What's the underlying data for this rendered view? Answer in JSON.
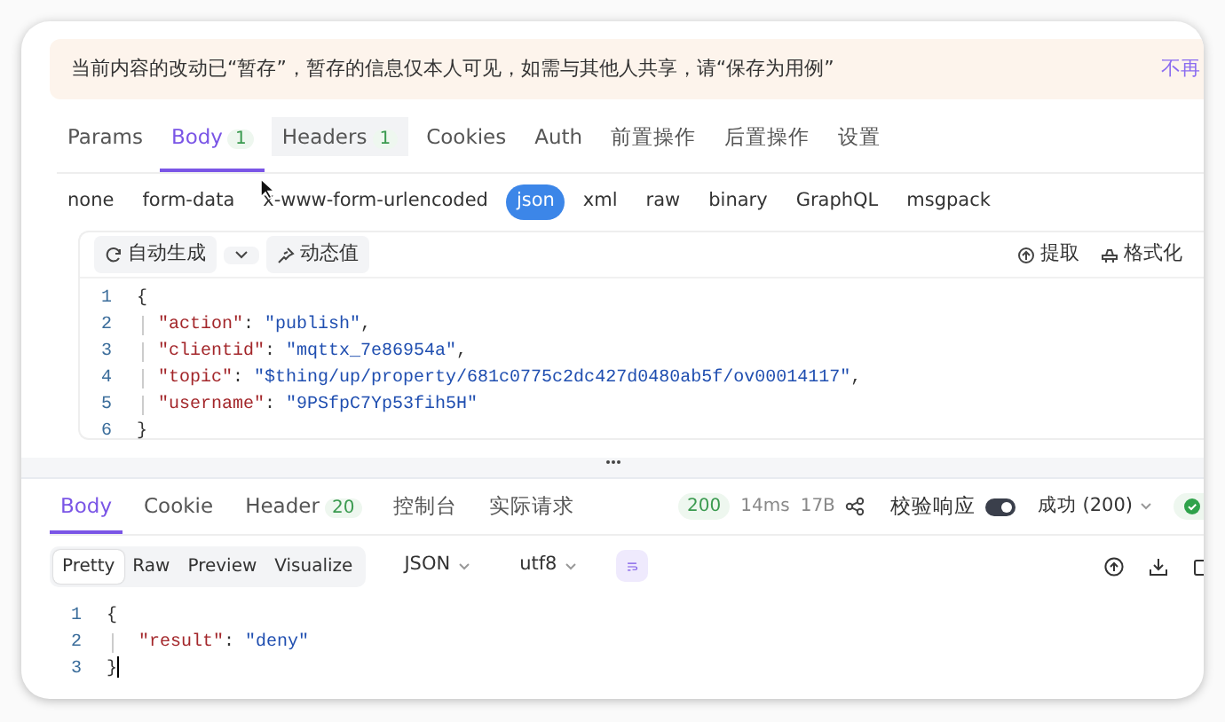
{
  "notice": {
    "text": "当前内容的改动已“暂存”，暂存的信息仅本人可见，如需与其他人共享，请“保存为用例”",
    "action": "不再"
  },
  "request_tabs": [
    {
      "label": "Params",
      "selected": false,
      "hovered": false
    },
    {
      "label": "Body",
      "count": "1",
      "selected": true,
      "hovered": false
    },
    {
      "label": "Headers",
      "count": "1",
      "selected": false,
      "hovered": true
    },
    {
      "label": "Cookies",
      "selected": false,
      "hovered": false
    },
    {
      "label": "Auth",
      "selected": false,
      "hovered": false
    },
    {
      "label": "前置操作",
      "selected": false,
      "hovered": false
    },
    {
      "label": "后置操作",
      "selected": false,
      "hovered": false
    },
    {
      "label": "设置",
      "selected": false,
      "hovered": false
    }
  ],
  "body_types": [
    {
      "label": "none",
      "selected": false
    },
    {
      "label": "form-data",
      "selected": false
    },
    {
      "label": "x-www-form-urlencoded",
      "selected": false
    },
    {
      "label": "json",
      "selected": true
    },
    {
      "label": "xml",
      "selected": false
    },
    {
      "label": "raw",
      "selected": false
    },
    {
      "label": "binary",
      "selected": false
    },
    {
      "label": "GraphQL",
      "selected": false
    },
    {
      "label": "msgpack",
      "selected": false
    }
  ],
  "editor": {
    "generate": "自动生成",
    "dynamic": "动态值",
    "extract": "提取",
    "format": "格式化",
    "lines": [
      {
        "number": "1",
        "tokens": [
          {
            "kind": "punct",
            "text": "{"
          }
        ]
      },
      {
        "number": "2",
        "tokens": [
          {
            "kind": "key",
            "text": "\"action\""
          },
          {
            "kind": "punct",
            "text": ": "
          },
          {
            "kind": "string",
            "text": "\"publish\""
          },
          {
            "kind": "punct",
            "text": ","
          }
        ]
      },
      {
        "number": "3",
        "tokens": [
          {
            "kind": "key",
            "text": "\"clientid\""
          },
          {
            "kind": "punct",
            "text": ": "
          },
          {
            "kind": "string",
            "text": "\"mqttx_7e86954a\""
          },
          {
            "kind": "punct",
            "text": ","
          }
        ]
      },
      {
        "number": "4",
        "tokens": [
          {
            "kind": "key",
            "text": "\"topic\""
          },
          {
            "kind": "punct",
            "text": ": "
          },
          {
            "kind": "string",
            "text": "\"$thing/up/property/681c0775c2dc427d0480ab5f/ov00014117\""
          },
          {
            "kind": "punct",
            "text": ","
          }
        ]
      },
      {
        "number": "5",
        "tokens": [
          {
            "kind": "key",
            "text": "\"username\""
          },
          {
            "kind": "punct",
            "text": ": "
          },
          {
            "kind": "string",
            "text": "\"9PSfpC7Yp53fih5H\""
          }
        ]
      },
      {
        "number": "6",
        "tokens": [
          {
            "kind": "punct",
            "text": "}"
          }
        ]
      }
    ]
  },
  "response": {
    "tabs": [
      {
        "label": "Body",
        "selected": true
      },
      {
        "label": "Cookie",
        "selected": false
      },
      {
        "label": "Header",
        "count": "20",
        "selected": false
      },
      {
        "label": "控制台",
        "selected": false
      },
      {
        "label": "实际请求",
        "selected": false
      }
    ],
    "status": "200",
    "time": "14ms",
    "size": "17B",
    "validate_label": "校验响应",
    "validate_on": true,
    "result": "成功 (200)",
    "view_modes": [
      {
        "label": "Pretty",
        "selected": true
      },
      {
        "label": "Raw",
        "selected": false
      },
      {
        "label": "Preview",
        "selected": false
      },
      {
        "label": "Visualize",
        "selected": false
      }
    ],
    "format": "JSON",
    "encoding": "utf8",
    "wrap_on": true,
    "lines": [
      {
        "number": "1",
        "tokens": [
          {
            "kind": "punct",
            "text": "{"
          }
        ]
      },
      {
        "number": "2",
        "tokens": [
          {
            "kind": "key",
            "text": "\"result\""
          },
          {
            "kind": "punct",
            "text": ": "
          },
          {
            "kind": "string",
            "text": "\"deny\""
          }
        ]
      },
      {
        "number": "3",
        "tokens": [
          {
            "kind": "punct",
            "text": "}"
          }
        ]
      }
    ]
  }
}
